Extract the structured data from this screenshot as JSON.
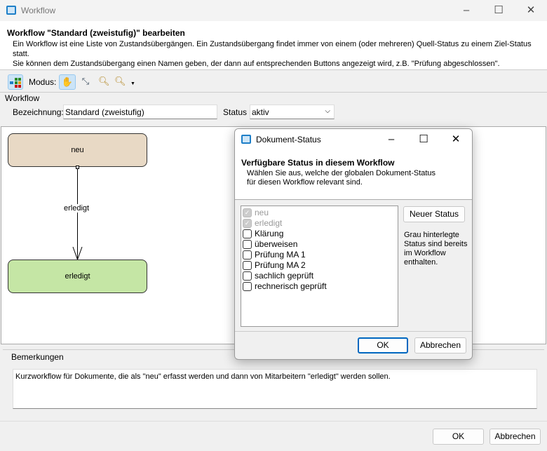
{
  "window": {
    "title": "Workflow",
    "heading": "Workflow \"Standard (zweistufig)\" bearbeiten",
    "description_line1": "Ein Workflow ist eine Liste von Zustandsübergängen. Ein Zustandsübergang findet immer von einem (oder mehreren) Quell-Status zu einem Ziel-Status statt.",
    "description_line2": "Sie können dem Zustandsübergang einen Namen geben, der dann auf entsprechenden Buttons angezeigt wird, z.B. \"Prüfung abgeschlossen\"."
  },
  "toolbar": {
    "mode_label": "Modus:"
  },
  "workflow_group": {
    "label": "Workflow",
    "name_label": "Bezeichnung:",
    "name_value": "Standard (zweistufig)",
    "status_label": "Status",
    "status_value": "aktiv"
  },
  "diagram": {
    "nodes": [
      {
        "label": "neu",
        "color": "#e8d9c5"
      },
      {
        "label": "erledigt",
        "color": "#c5e6a5"
      }
    ],
    "transition_label": "erledigt"
  },
  "remarks": {
    "label": "Bemerkungen",
    "text": "Kurzworkflow für Dokumente, die als \"neu\" erfasst werden und dann von Mitarbeitern \"erledigt\" werden sollen."
  },
  "footer": {
    "ok": "OK",
    "cancel": "Abbrechen"
  },
  "dialog": {
    "title": "Dokument-Status",
    "heading": "Verfügbare Status in diesem Workflow",
    "desc_line1": "Wählen Sie aus, welche der globalen Dokument-Status",
    "desc_line2": "für diesen Workflow relevant sind.",
    "items": [
      {
        "label": "neu",
        "checked": true,
        "disabled": true
      },
      {
        "label": "erledigt",
        "checked": true,
        "disabled": true
      },
      {
        "label": "Klärung",
        "checked": false
      },
      {
        "label": "überweisen",
        "checked": false
      },
      {
        "label": "Prüfung MA 1",
        "checked": false
      },
      {
        "label": "Prüfung MA 2",
        "checked": false
      },
      {
        "label": "sachlich geprüft",
        "checked": false
      },
      {
        "label": "rechnerisch geprüft",
        "checked": false
      }
    ],
    "new_status": "Neuer Status",
    "hint": "Grau hinterlegte Status sind bereits im Workflow enthalten.",
    "ok": "OK",
    "cancel": "Abbrechen"
  }
}
